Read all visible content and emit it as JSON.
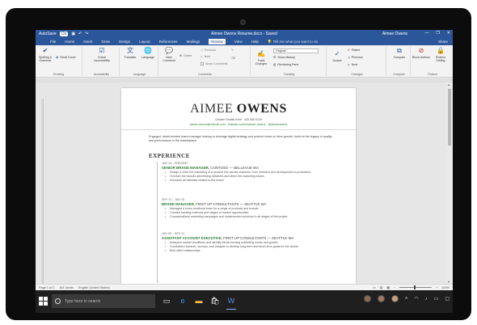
{
  "window": {
    "title": "Aimee Owens Resume.docx - Saved",
    "autosave": "AutoSave",
    "autosave_state": "On",
    "user": "Aimee Owens",
    "minimize": "—",
    "restore": "❐",
    "close": "✕"
  },
  "tabs": [
    "File",
    "Home",
    "Insert",
    "Draw",
    "Design",
    "Layout",
    "References",
    "Mailings",
    "Review",
    "View",
    "Help"
  ],
  "active_tab": "Review",
  "tell_me": "Tell me what you want to do",
  "share": "Share",
  "ribbon": {
    "spelling": "Spelling & Grammar",
    "word_count": "Word Count",
    "proofing": "Proofing",
    "check_accessibility": "Check Accessibility",
    "accessibility": "Accessibility",
    "translate": "Translate",
    "language": "Language",
    "language_group": "Language",
    "new_comment": "New Comment",
    "delete": "Delete",
    "previous": "Previous",
    "next": "Next",
    "show_comments": "Show Comments",
    "comments": "Comments",
    "ink": "Ink",
    "track_changes": "Track Changes",
    "markup": "Original",
    "show_markup": "Show Markup",
    "reviewing_pane": "Reviewing Pane",
    "tracking": "Tracking",
    "accept": "Accept",
    "reject": "Reject",
    "changes_previous": "Previous",
    "changes_next": "Next",
    "changes": "Changes",
    "compare": "Compare",
    "compare_group": "Compare",
    "block_authors": "Block Authors",
    "restrict_editing": "Restrict Editing",
    "protect": "Protect"
  },
  "resume": {
    "first_name": "AIMEE",
    "last_name": "OWENS",
    "contact": "Greater Seattle Area · 425 555 0139",
    "links": "aimee.owens@outlook.com · linkedin.com/in/aimee-owens · @aimeeowens",
    "summary": "Engaged, detail-minded brand manager looking to leverage digital strategy and product vision to drive growth, build on the legacy of quality and performance in the marketplace.",
    "section_title": "EXPERIENCE",
    "jobs": [
      {
        "dates": "JAN '15 – PRESENT",
        "title": "SENIOR BRAND MANAGER,",
        "org": " CONTOSO — BELLEVUE WA",
        "bullets": [
          "Design & drive the marketing of a product line across channels, from research and development to production.",
          "Oversee the brand's advertising initiatives and direct the marketing teams.",
          "Schedule all activities related to the brand."
        ]
      },
      {
        "dates": "SEP '11 – JAN '15",
        "title": "BRAND MANAGER,",
        "org": " FIRST UP CONSULTANTS — SEATTLE WA",
        "bullets": [
          "Managed a cross-functional team for a range of products and brands.",
          "Created tracking methods and stages of market opportunities.",
          "Conceptualized marketing campaigns and implemented solutions in all stages of the project."
        ]
      },
      {
        "dates": "JAN '09 – SEP '11",
        "title": "ASSISTANT ACCOUNT EXECUTIVE,",
        "org": " FIRST UP CONSULTANTS — SEATTLE WA",
        "bullets": [
          "Analyzed market conditions and identify trends forming marketing needs and growth.",
          "Conducted research, surveys, and analysis to develop long-term and short-term goals for the clients.",
          "Built client relationships."
        ]
      }
    ]
  },
  "status": {
    "page": "Page 1 of 2",
    "words": "441 words",
    "language": "English (United States)",
    "zoom": "100%"
  },
  "taskbar": {
    "search_placeholder": "Type here to search"
  }
}
